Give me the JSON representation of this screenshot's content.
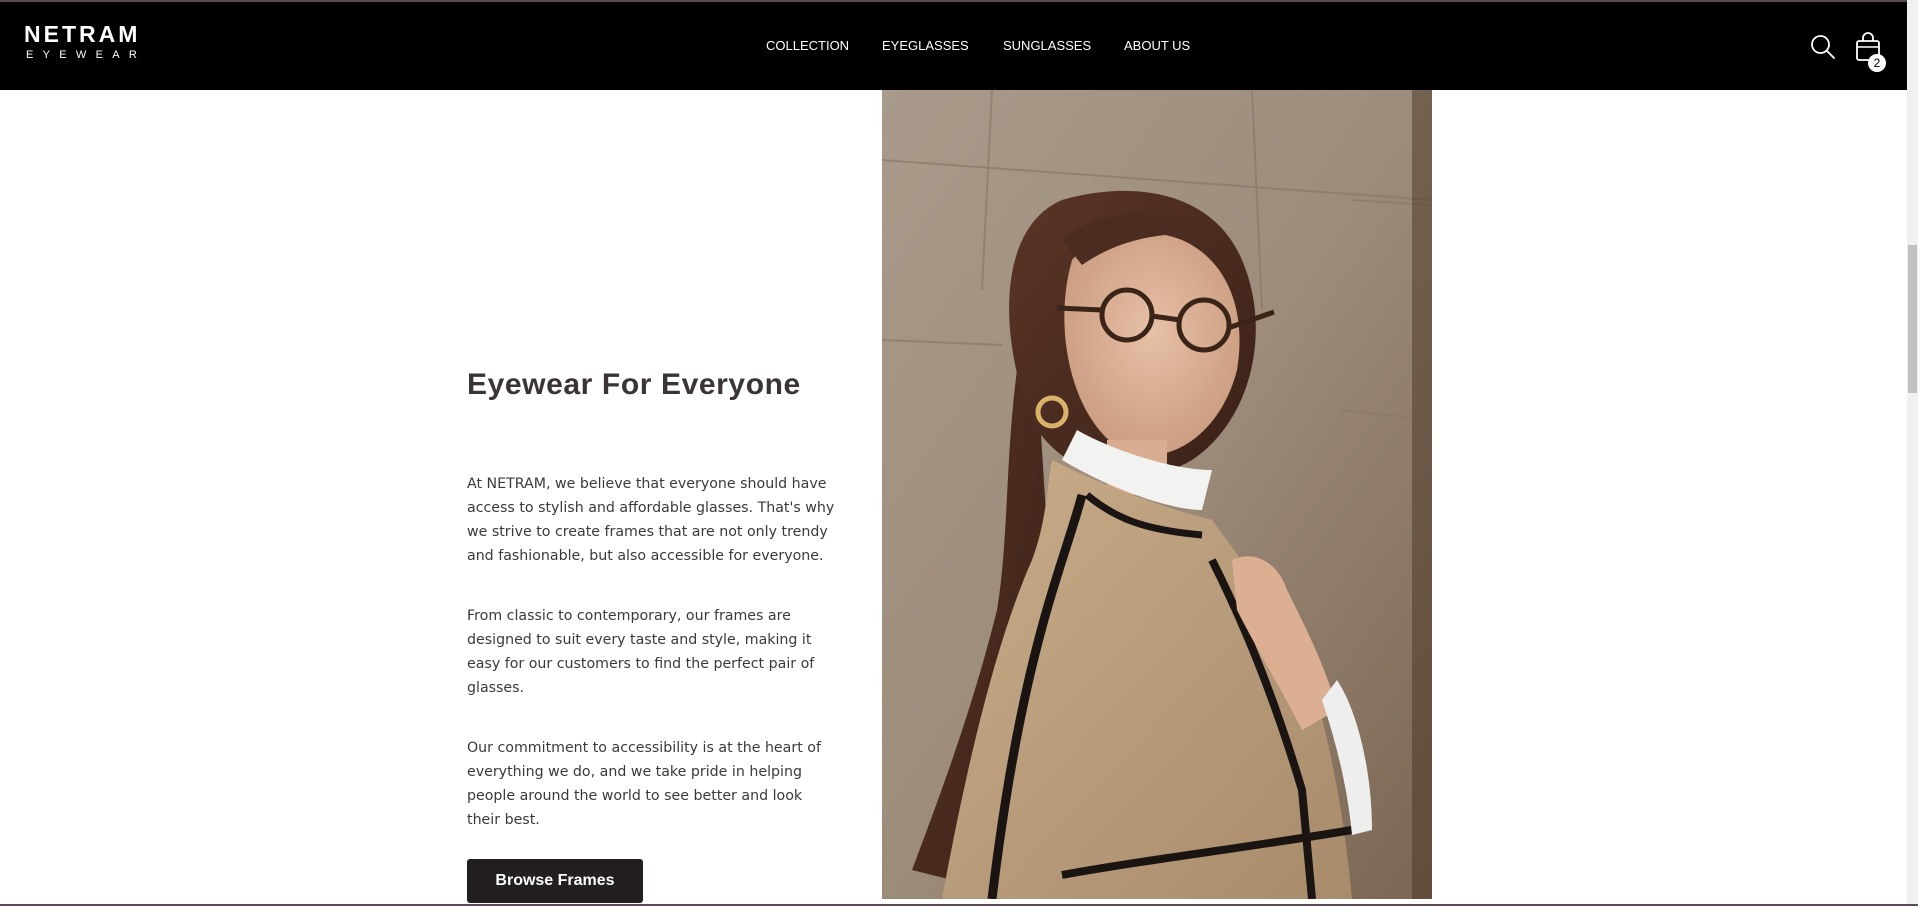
{
  "brand": {
    "name": "NETRAM",
    "tagline": "EYEWEAR"
  },
  "nav": {
    "items": [
      {
        "label": "COLLECTION"
      },
      {
        "label": "EYEGLASSES"
      },
      {
        "label": "SUNGLASSES"
      },
      {
        "label": "ABOUT US"
      }
    ]
  },
  "header_icons": {
    "search_icon": "search-icon",
    "cart_icon": "shopping-bag-icon",
    "cart_count": "2"
  },
  "hero": {
    "title": "Eyewear For Everyone",
    "paragraphs": [
      "At NETRAM, we believe that everyone should have access to stylish and affordable glasses. That's why we strive to create frames that are not only trendy and fashionable, but also accessible for everyone.",
      "From classic to contemporary, our frames are designed to suit every taste and style, making it easy for our customers to find the perfect pair of glasses.",
      "Our commitment to accessibility is at the heart of everything we do, and we take pride in helping people around the world to see better and look their best."
    ],
    "button_label": "Browse Frames"
  },
  "colors": {
    "header_bg": "#000000",
    "heading": "#3b3434",
    "button_bg": "#231f20"
  }
}
